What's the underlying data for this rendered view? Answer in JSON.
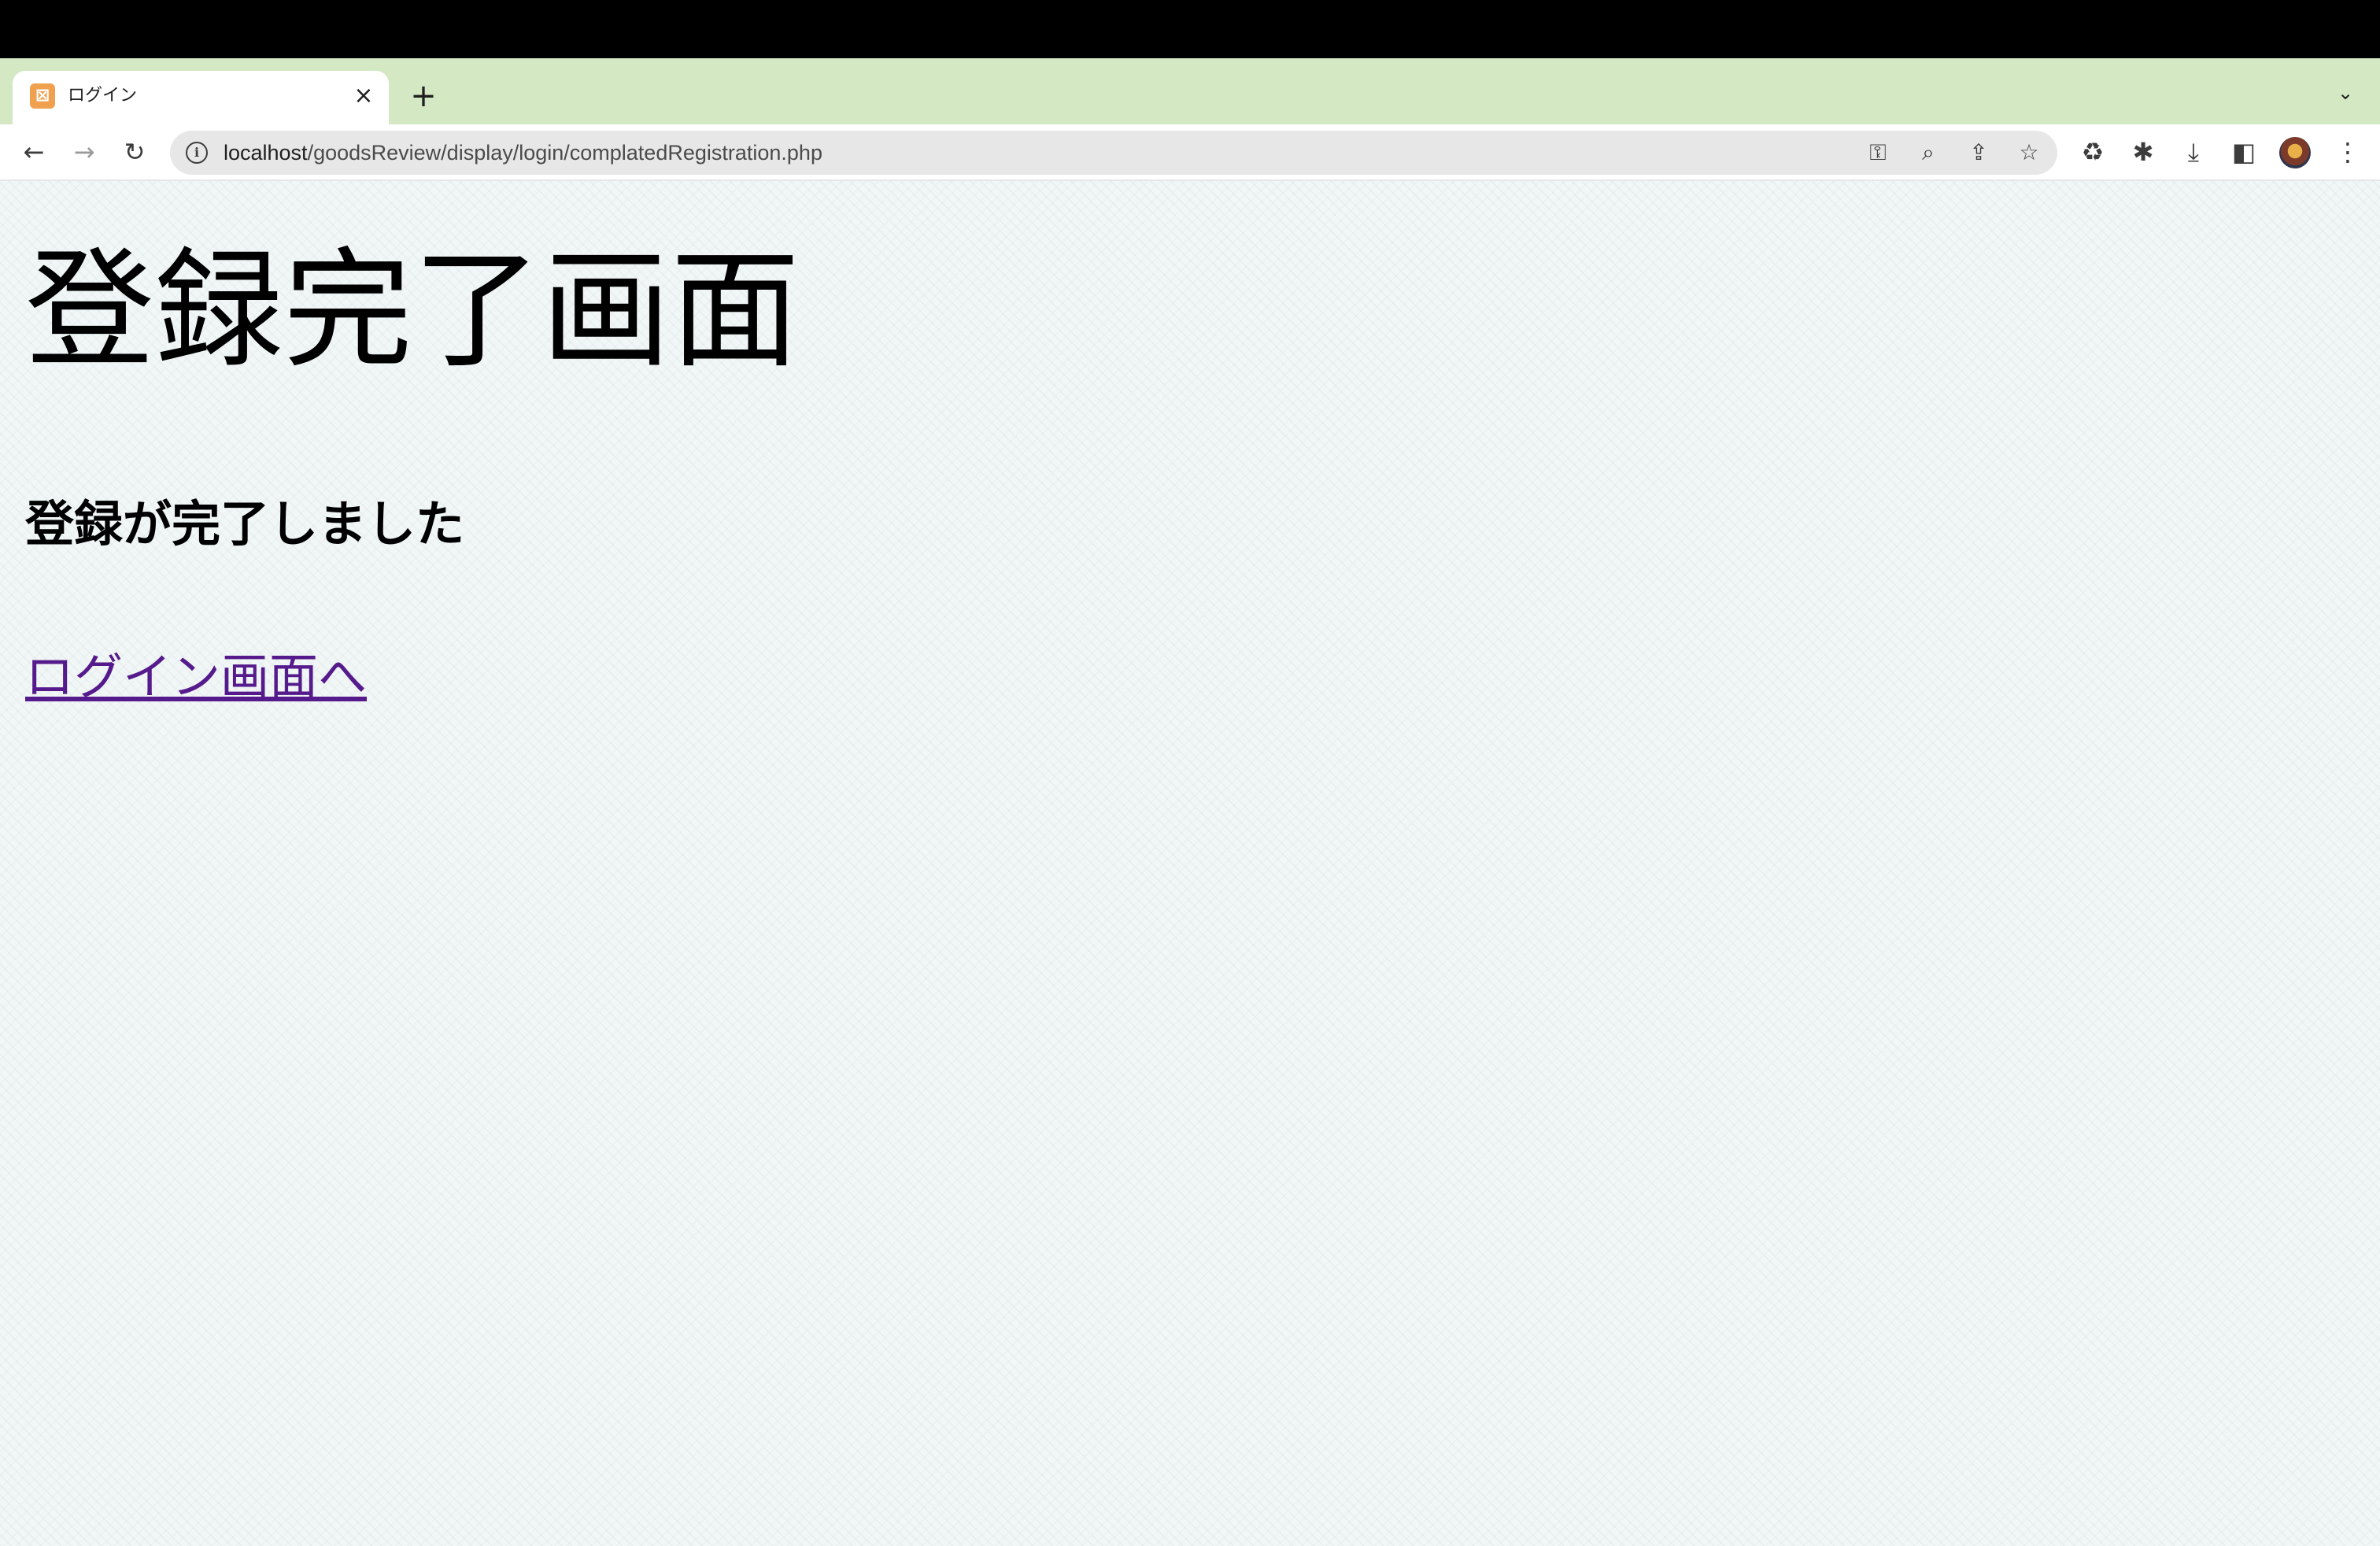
{
  "browser": {
    "tab": {
      "title": "ログイン",
      "favicon_icon": "xampp-icon",
      "close_symbol": "×"
    },
    "new_tab_symbol": "+",
    "tab_dropdown_symbol": "⌄",
    "toolbar": {
      "back_symbol": "←",
      "forward_symbol": "→",
      "reload_symbol": "↻"
    },
    "address": {
      "info_symbol": "i",
      "host": "localhost",
      "path": "/goodsReview/display/login/complatedRegistration.php"
    },
    "omnibox_icons": {
      "key": "⚿",
      "zoom": "⌕",
      "share": "⇪",
      "bookmark": "☆"
    },
    "extension_icons": {
      "recycle": "♻",
      "puzzle": "✱",
      "download": "⤓",
      "side_panel": "◧",
      "menu": "⋮"
    }
  },
  "page": {
    "title": "登録完了画面",
    "message": "登録が完了しました",
    "link_label": "ログイン画面へ"
  },
  "colors": {
    "tabstrip": "#d3e8c3",
    "page_background": "#f1f6f6",
    "link": "#551a8b"
  }
}
